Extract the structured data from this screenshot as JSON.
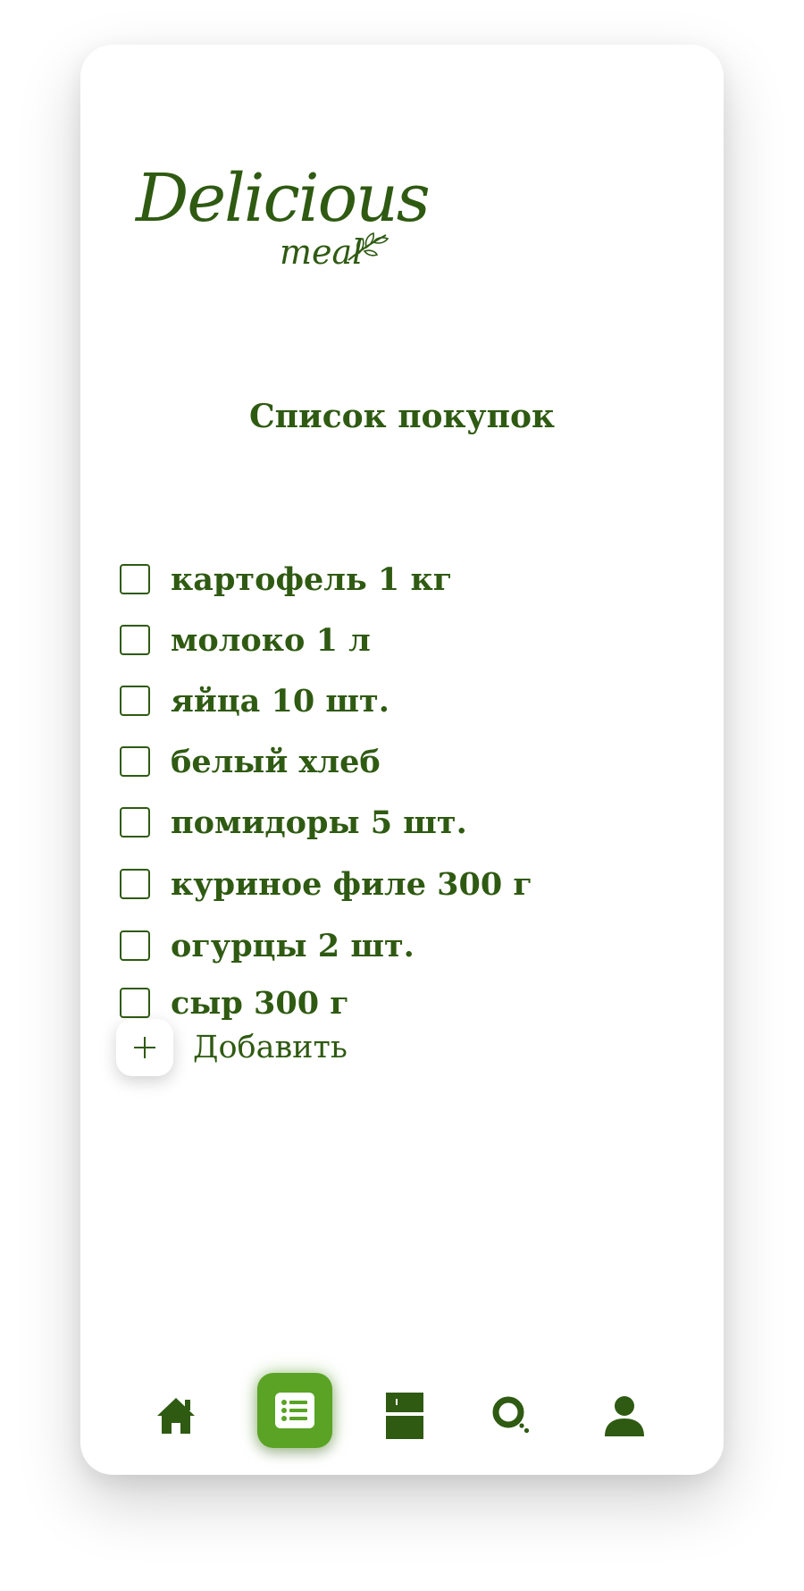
{
  "brand": {
    "logo_main": "Delicious",
    "logo_sub": "meal"
  },
  "page": {
    "title": "Список покупок"
  },
  "shopping_list": {
    "items": [
      {
        "label": "картофель 1 кг",
        "checked": false
      },
      {
        "label": "молоко 1 л",
        "checked": false
      },
      {
        "label": "яйца 10 шт.",
        "checked": false
      },
      {
        "label": "белый хлеб",
        "checked": false
      },
      {
        "label": "помидоры 5 шт.",
        "checked": false
      },
      {
        "label": "куриное филе 300 г",
        "checked": false
      },
      {
        "label": "огурцы 2 шт.",
        "checked": false
      },
      {
        "label": "сыр 300 г",
        "checked": false
      }
    ],
    "add_label": "Добавить"
  },
  "nav": {
    "items": [
      {
        "icon": "home-icon",
        "active": false
      },
      {
        "icon": "list-icon",
        "active": true
      },
      {
        "icon": "fridge-icon",
        "active": false
      },
      {
        "icon": "search-icon",
        "active": false
      },
      {
        "icon": "user-icon",
        "active": false
      }
    ]
  },
  "colors": {
    "primary": "#2f5a12",
    "accent": "#5aa325",
    "background": "#ffffff"
  }
}
